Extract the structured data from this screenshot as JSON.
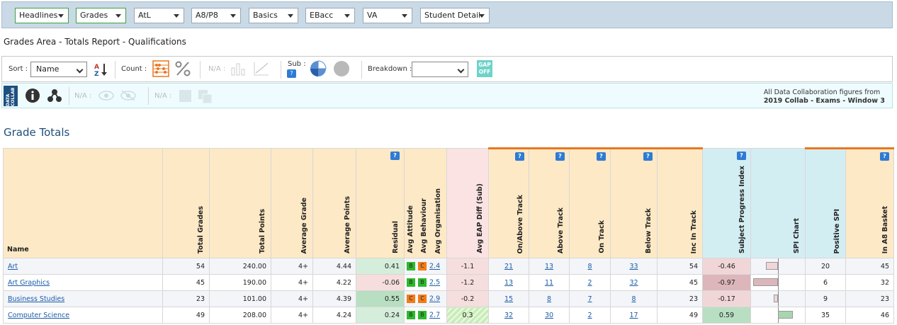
{
  "filters": [
    {
      "label": "Headlines",
      "active": true
    },
    {
      "label": "Grades",
      "active": true
    },
    {
      "label": "AtL",
      "active": false
    },
    {
      "label": "A8/P8",
      "active": false
    },
    {
      "label": "Basics",
      "active": false
    },
    {
      "label": "EBacc",
      "active": false
    },
    {
      "label": "VA",
      "active": false
    },
    {
      "label": "Student Detail",
      "active": false
    }
  ],
  "report_title": "Grades Area - Totals Report - Qualifications",
  "toolbar": {
    "sort_label": "Sort :",
    "sort_value": "Name",
    "count_label": "Count :",
    "na1": "N/A :",
    "sub_label": "Sub :",
    "sub_help": "?",
    "breakdown_label": "Breakdown :",
    "breakdown_value": "",
    "gap_line1": "GAP",
    "gap_line2": "OFF"
  },
  "collab": {
    "logo_text": "DATA COLLAB",
    "na2": "N/A :",
    "na3": "N/A :",
    "note_line1": "All Data Collaboration figures from",
    "note_line2": "2019 Collab - Exams - Window 3"
  },
  "section_title": "Grade Totals",
  "columns": {
    "name": "Name",
    "total_grades": "Total Grades",
    "total_points": "Total Points",
    "average_grade": "Average Grade",
    "average_points": "Average Points",
    "residual": "Residual",
    "avg_attitude": "Avg Attitude",
    "avg_behaviour": "Avg Behaviour",
    "avg_organisation": "Avg Organisation",
    "avg_eap_diff": "Avg EAP Diff (Sub)",
    "on_above_track": "On/Above Track",
    "above_track": "Above Track",
    "on_track": "On Track",
    "below_track": "Below Track",
    "inc_in_track": "Inc In Track",
    "spi": "Subject Progress Index",
    "spi_chart": "SPI Chart",
    "positive_spi": "Positive SPI",
    "in_a8_basket": "In A8 Basket",
    "help": "?"
  },
  "rows": [
    {
      "name": "Art",
      "total_grades": "54",
      "total_points": "240.00",
      "average_grade": "4+",
      "average_points": "4.44",
      "residual": "0.41",
      "attitude": "B",
      "behaviour": "C",
      "organisation": "2.4",
      "eap_diff": "-1.1",
      "on_above": "21",
      "above": "13",
      "on": "8",
      "below": "33",
      "inc": "54",
      "spi": "-0.46",
      "spi_value": -0.46,
      "positive_spi": "20",
      "a8": "45"
    },
    {
      "name": "Art Graphics",
      "total_grades": "45",
      "total_points": "190.00",
      "average_grade": "4+",
      "average_points": "4.22",
      "residual": "-0.06",
      "attitude": "B",
      "behaviour": "B",
      "organisation": "2.5",
      "eap_diff": "-1.2",
      "on_above": "13",
      "above": "11",
      "on": "2",
      "below": "32",
      "inc": "45",
      "spi": "-0.97",
      "spi_value": -0.97,
      "positive_spi": "6",
      "a8": "32"
    },
    {
      "name": "Business Studies",
      "total_grades": "23",
      "total_points": "101.00",
      "average_grade": "4+",
      "average_points": "4.39",
      "residual": "0.55",
      "attitude": "C",
      "behaviour": "C",
      "organisation": "2.9",
      "eap_diff": "-0.2",
      "on_above": "15",
      "above": "8",
      "on": "7",
      "below": "8",
      "inc": "23",
      "spi": "-0.17",
      "spi_value": -0.17,
      "positive_spi": "9",
      "a8": "23"
    },
    {
      "name": "Computer Science",
      "total_grades": "49",
      "total_points": "208.00",
      "average_grade": "4+",
      "average_points": "4.24",
      "residual": "0.24",
      "attitude": "B",
      "behaviour": "B",
      "organisation": "2.7",
      "eap_diff": "0.3",
      "on_above": "32",
      "above": "30",
      "on": "2",
      "below": "17",
      "inc": "49",
      "spi": "0.59",
      "spi_value": 0.59,
      "positive_spi": "35",
      "a8": "46"
    }
  ],
  "colors": {
    "header_fill": "#fde9c6",
    "teal_header": "#d3eef3",
    "accent_orange": "#e87722",
    "help_blue": "#2f7bd3",
    "badge_green": "#2db82d",
    "badge_orange": "#f07c1a"
  }
}
